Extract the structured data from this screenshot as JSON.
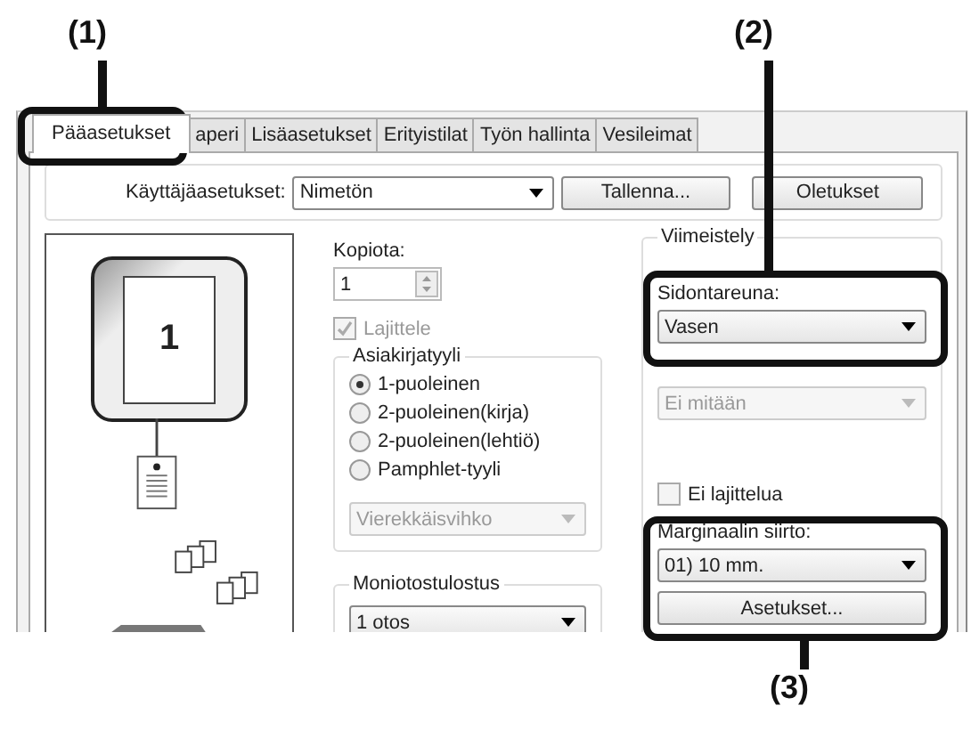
{
  "callouts": [
    {
      "label": "(1)"
    },
    {
      "label": "(2)"
    },
    {
      "label": "(3)"
    }
  ],
  "tabs": [
    {
      "label": "Pääasetukset",
      "selected": true
    },
    {
      "label": "aperi",
      "selected": false
    },
    {
      "label": "Lisäasetukset",
      "selected": false
    },
    {
      "label": "Erityistilat",
      "selected": false
    },
    {
      "label": "Työn hallinta",
      "selected": false
    },
    {
      "label": "Vesileimat",
      "selected": false
    }
  ],
  "user_settings": {
    "label": "Käyttäjäasetukset:",
    "value": "Nimetön",
    "buttons": [
      "Tallenna...",
      "Oletukset"
    ]
  },
  "preview": {
    "page_number": "1"
  },
  "copies": {
    "label": "Kopiota:",
    "value": "1"
  },
  "collate": {
    "label": "Lajittele",
    "checked": true,
    "disabled": true
  },
  "document_style": {
    "title": "Asiakirjatyyli",
    "options": [
      {
        "label": "1-puoleinen",
        "selected": true
      },
      {
        "label": "2-puoleinen(kirja)",
        "selected": false
      },
      {
        "label": "2-puoleinen(lehtiö)",
        "selected": false
      },
      {
        "label": "Pamphlet-tyyli",
        "selected": false
      }
    ],
    "booklet": {
      "value": "Vierekkäisvihko",
      "disabled": true
    }
  },
  "multi_copy": {
    "title": "Moniotostulostus",
    "value": "1 otos"
  },
  "finishing": {
    "title": "Viimeistely",
    "binding": {
      "label": "Sidontareuna:",
      "value": "Vasen"
    },
    "punch": {
      "value": "Ei mitään",
      "disabled": true
    },
    "no_offset": {
      "label": "Ei lajittelua",
      "checked": false
    },
    "margin_shift": {
      "label": "Marginaalin siirto:",
      "value": "01) 10 mm."
    },
    "settings_button": "Asetukset..."
  }
}
